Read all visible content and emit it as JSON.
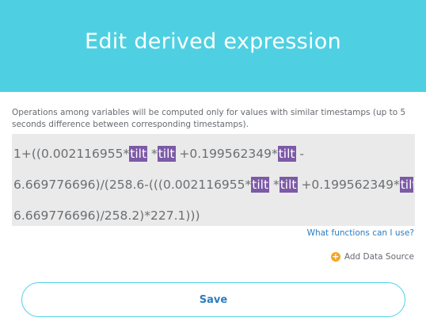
{
  "header": {
    "title": "Edit derived expression"
  },
  "note": "Operations among variables will be computed only for values with similar timestamps (up to 5 seconds difference between corresponding timestamps).",
  "expression": {
    "lines": [
      [
        {
          "type": "text",
          "value": "1+((0.002116955*"
        },
        {
          "type": "var",
          "value": "tilt"
        },
        {
          "type": "text",
          "value": " *"
        },
        {
          "type": "var",
          "value": "tilt"
        },
        {
          "type": "text",
          "value": " +0.199562349*"
        },
        {
          "type": "var",
          "value": "tilt"
        },
        {
          "type": "text",
          "value": " -"
        }
      ],
      [
        {
          "type": "text",
          "value": "6.669776696)/(258.6-(((0.002116955*"
        },
        {
          "type": "var",
          "value": "tilt"
        },
        {
          "type": "text",
          "value": " *"
        },
        {
          "type": "var",
          "value": "tilt"
        },
        {
          "type": "text",
          "value": " +0.199562349*"
        },
        {
          "type": "var",
          "value": "tilt"
        },
        {
          "type": "text",
          "value": " -"
        }
      ],
      [
        {
          "type": "text",
          "value": "6.669776696)/258.2)*227.1)))"
        }
      ]
    ]
  },
  "links": {
    "help": "What functions can I use?",
    "add_source": "Add Data Source"
  },
  "buttons": {
    "save": "Save"
  },
  "colors": {
    "header_bg": "#4ed0e2",
    "variable_bg": "#7c5aa6",
    "link": "#2b7cc0",
    "plus_icon": "#f5a623"
  }
}
